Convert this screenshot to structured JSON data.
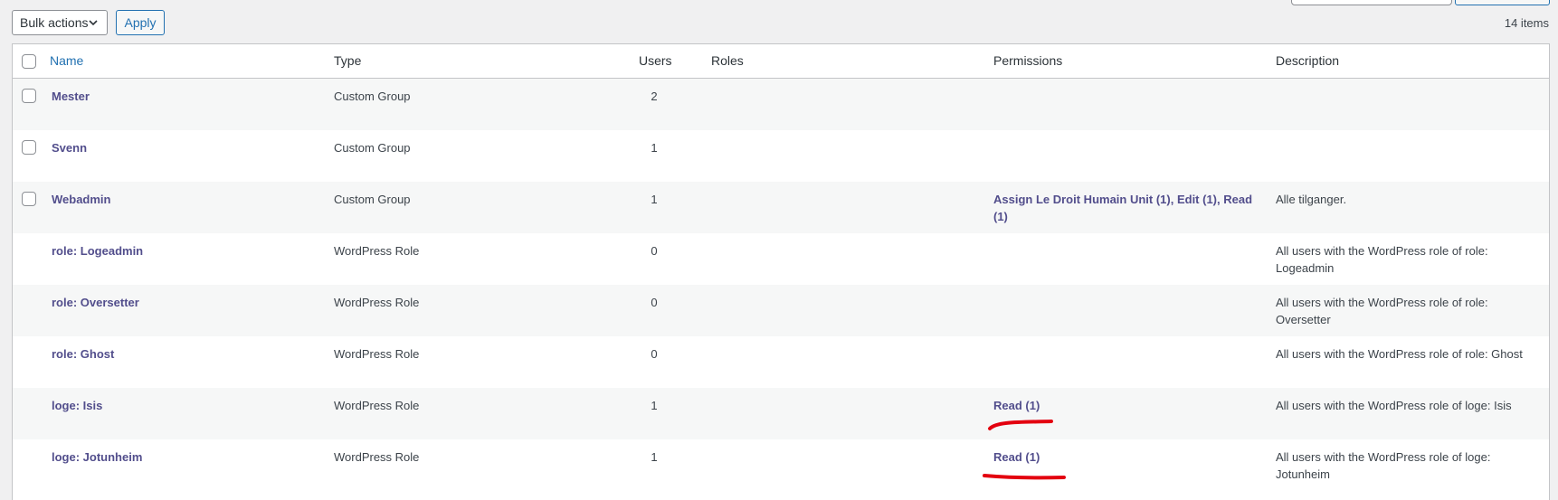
{
  "toolbar": {
    "bulk_actions_label": "Bulk actions",
    "apply_label": "Apply",
    "item_count": "14 items"
  },
  "table": {
    "columns": {
      "name": "Name",
      "type": "Type",
      "users": "Users",
      "roles": "Roles",
      "permissions": "Permissions",
      "description": "Description"
    },
    "rows": [
      {
        "name": "Mester",
        "type": "Custom Group",
        "users": "2",
        "roles": "",
        "permissions": "",
        "description": "",
        "has_checkbox": true
      },
      {
        "name": "Svenn",
        "type": "Custom Group",
        "users": "1",
        "roles": "",
        "permissions": "",
        "description": "",
        "has_checkbox": true
      },
      {
        "name": "Webadmin",
        "type": "Custom Group",
        "users": "1",
        "roles": "",
        "permissions": "Assign Le Droit Humain Unit (1), Edit (1), Read (1)",
        "description": "Alle tilganger.",
        "has_checkbox": true
      },
      {
        "name": "role: Logeadmin",
        "type": "WordPress Role",
        "users": "0",
        "roles": "",
        "permissions": "",
        "description": "All users with the WordPress role of role: Logeadmin",
        "has_checkbox": false
      },
      {
        "name": "role: Oversetter",
        "type": "WordPress Role",
        "users": "0",
        "roles": "",
        "permissions": "",
        "description": "All users with the WordPress role of role: Oversetter",
        "has_checkbox": false
      },
      {
        "name": "role: Ghost",
        "type": "WordPress Role",
        "users": "0",
        "roles": "",
        "permissions": "",
        "description": "All users with the WordPress role of role: Ghost",
        "has_checkbox": false
      },
      {
        "name": "loge: Isis",
        "type": "WordPress Role",
        "users": "1",
        "roles": "",
        "permissions": "Read (1)",
        "description": "All users with the WordPress role of loge: Isis",
        "has_checkbox": false
      },
      {
        "name": "loge: Jotunheim",
        "type": "WordPress Role",
        "users": "1",
        "roles": "",
        "permissions": "Read (1)",
        "description": "All users with the WordPress role of loge: Jotunheim",
        "has_checkbox": false
      }
    ]
  },
  "colors": {
    "link": "#524e8c",
    "accent": "#2271b1",
    "annotation_red": "#e3000f",
    "row_alt": "#f6f7f7",
    "border": "#c3c4c7"
  },
  "icons": {
    "bulk_dropdown": "chevron-down-icon"
  }
}
